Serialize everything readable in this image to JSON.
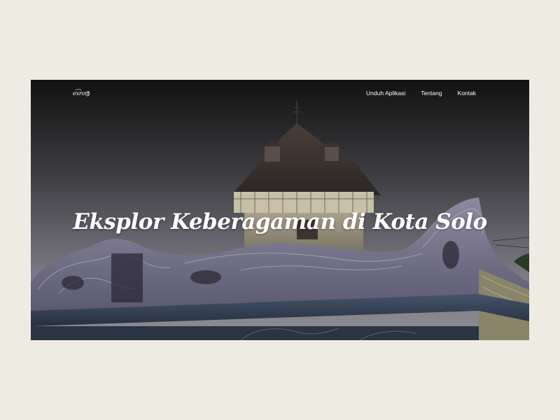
{
  "logo": {
    "text": "exrort",
    "icon": "script-logo-icon"
  },
  "nav": {
    "items": [
      {
        "label": "Unduh Aplikasi"
      },
      {
        "label": "Tentang"
      },
      {
        "label": "Kontak"
      }
    ]
  },
  "hero": {
    "title": "Eksplor Keberagaman di Kota Solo",
    "background": "photo of ornate Javanese carved palace rooftop with tower at dusk"
  },
  "colors": {
    "page_background": "#eeebe3",
    "text": "#ffffff",
    "sky_top": "#141414",
    "sky_bottom": "#8a8892"
  }
}
